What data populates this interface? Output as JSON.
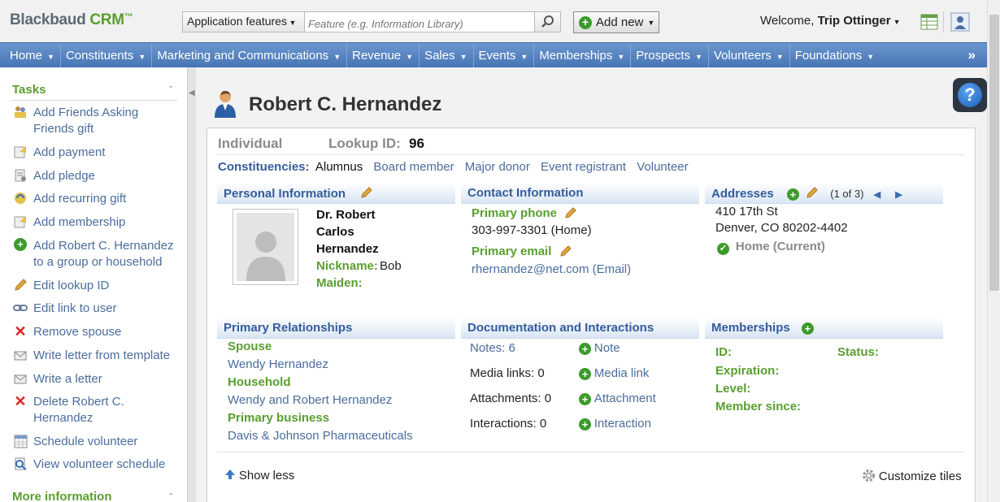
{
  "app": {
    "brand_main": "Blackbaud",
    "brand_crm": "CRM",
    "brand_tm": "™"
  },
  "search": {
    "scope": "Application features",
    "placeholder": "Feature (e.g. Information Library)"
  },
  "toolbar": {
    "add_new": "Add new"
  },
  "user": {
    "welcome": "Welcome,",
    "name": "Trip Ottinger"
  },
  "nav": {
    "items": [
      "Home",
      "Constituents",
      "Marketing and Communications",
      "Revenue",
      "Sales",
      "Events",
      "Memberships",
      "Prospects",
      "Volunteers",
      "Foundations"
    ],
    "more": "»"
  },
  "sidebar": {
    "tasks_heading": "Tasks",
    "more_heading": "More information",
    "tasks": [
      {
        "label": "Add Friends Asking Friends gift",
        "icon": "friends-gift-icon"
      },
      {
        "label": "Add payment",
        "icon": "payment-icon"
      },
      {
        "label": "Add pledge",
        "icon": "pledge-icon"
      },
      {
        "label": "Add recurring gift",
        "icon": "recurring-gift-icon"
      },
      {
        "label": "Add membership",
        "icon": "membership-icon"
      },
      {
        "label": "Add Robert C. Hernandez to a group or household",
        "icon": "add-icon"
      },
      {
        "label": "Edit lookup ID",
        "icon": "pencil-icon"
      },
      {
        "label": "Edit link to user",
        "icon": "link-icon"
      },
      {
        "label": "Remove spouse",
        "icon": "remove-icon"
      },
      {
        "label": "Write letter from template",
        "icon": "letter-template-icon"
      },
      {
        "label": "Write a letter",
        "icon": "letter-icon"
      },
      {
        "label": "Delete Robert C. Hernandez",
        "icon": "delete-icon"
      },
      {
        "label": "Schedule volunteer",
        "icon": "calendar-icon"
      },
      {
        "label": "View volunteer schedule",
        "icon": "view-schedule-icon"
      }
    ]
  },
  "record": {
    "title": "Robert C. Hernandez",
    "type": "Individual",
    "lookup_label": "Lookup ID:",
    "lookup_value": "96",
    "constituencies_label": "Constituencies:",
    "constituencies": [
      "Alumnus",
      "Board member",
      "Major donor",
      "Event registrant",
      "Volunteer"
    ]
  },
  "personal": {
    "heading": "Personal Information",
    "name_line1": "Dr. Robert",
    "name_line2": "Carlos",
    "name_line3": "Hernandez",
    "nickname_label": "Nickname:",
    "nickname": "Bob",
    "maiden_label": "Maiden:"
  },
  "contact": {
    "heading": "Contact Information",
    "phone_label": "Primary phone",
    "phone": "303-997-3301 (Home)",
    "email_label": "Primary email",
    "email": "rhernandez@net.com (Email)"
  },
  "addresses": {
    "heading": "Addresses",
    "pager": "(1 of 3)",
    "street": "410 17th St",
    "city": "Denver, CO 80202-4402",
    "status": "Home (Current)"
  },
  "relationships": {
    "heading": "Primary Relationships",
    "spouse_label": "Spouse",
    "spouse": "Wendy Hernandez",
    "household_label": "Household",
    "household": "Wendy and Robert Hernandez",
    "business_label": "Primary business",
    "business": "Davis & Johnson Pharmaceuticals"
  },
  "documentation": {
    "heading": "Documentation and Interactions",
    "notes": "Notes: 6",
    "media": "Media links: 0",
    "attachments": "Attachments: 0",
    "interactions": "Interactions: 0",
    "add_note": "Note",
    "add_media": "Media link",
    "add_attachment": "Attachment",
    "add_interaction": "Interaction"
  },
  "memberships": {
    "heading": "Memberships",
    "id_label": "ID:",
    "status_label": "Status:",
    "expiration_label": "Expiration:",
    "level_label": "Level:",
    "since_label": "Member since:"
  },
  "footer": {
    "show_less": "Show less",
    "customize": "Customize tiles"
  },
  "colors": {
    "nav_blue": "#4775b5",
    "green": "#5a9e2f",
    "link": "#4a6d9c",
    "heading_blue": "#355d9a"
  }
}
